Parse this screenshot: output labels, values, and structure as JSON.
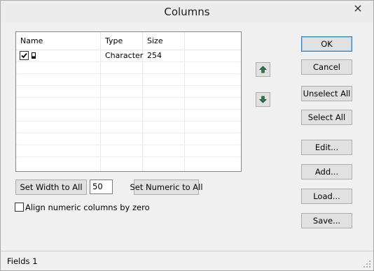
{
  "window": {
    "title": "Columns"
  },
  "grid": {
    "headers": [
      "Name",
      "Type",
      "Size"
    ],
    "rows": [
      {
        "checked": true,
        "name": "",
        "type": "Character",
        "size": "254"
      }
    ]
  },
  "buttons": {
    "ok": "OK",
    "cancel": "Cancel",
    "unselect_all": "Unselect All",
    "select_all": "Select All",
    "edit": "Edit...",
    "add": "Add...",
    "load": "Load...",
    "save": "Save...",
    "set_width_to_all": "Set Width to All",
    "set_numeric_to_all": "Set Numeric to All"
  },
  "width_value": "50",
  "align_numeric": {
    "label": "Align numeric columns by zero",
    "checked": false
  },
  "status": {
    "text": "Fields 1"
  },
  "icons": {
    "move_up": "arrow-up-icon",
    "move_down": "arrow-down-icon",
    "close": "close-icon",
    "row_key": "key-icon"
  },
  "colors": {
    "arrow": "#2a7a4f",
    "default_border": "#3c7fb1"
  }
}
